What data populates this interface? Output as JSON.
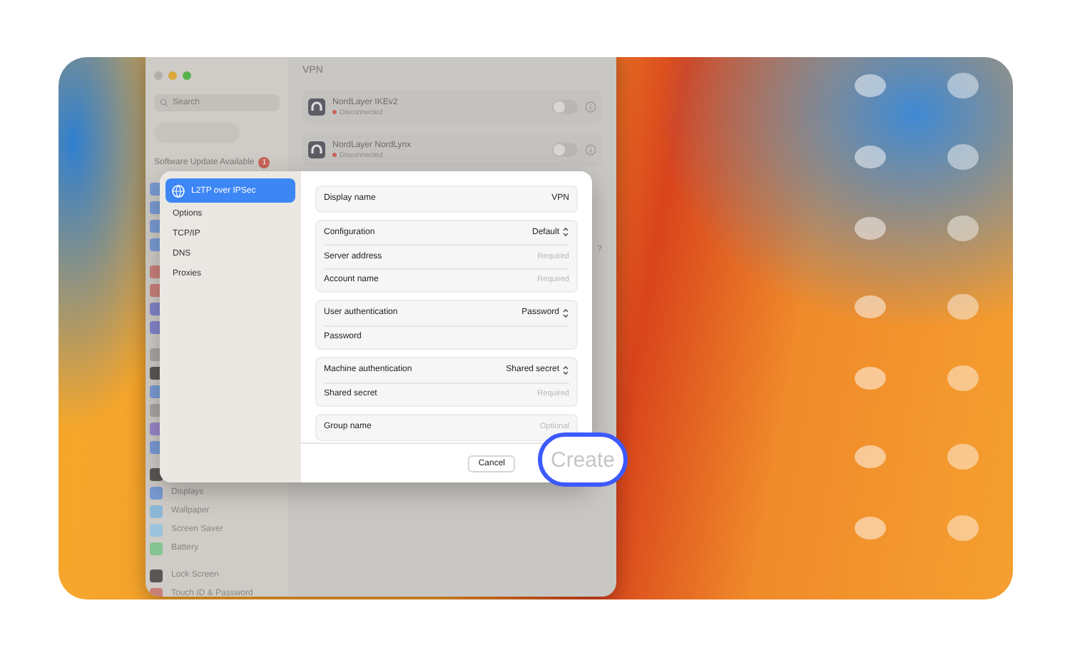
{
  "settings_window": {
    "sidebar": {
      "search": {
        "placeholder": "Search"
      },
      "notice": {
        "text": "Software Update Available",
        "badge": "1"
      },
      "groups": [
        [
          {
            "color": "#7a9cd4"
          },
          {
            "color": "#7a9cd4"
          },
          {
            "color": "#7a9cd4"
          },
          {
            "color": "#7a9cd4"
          }
        ],
        [
          {
            "color": "#c98078"
          },
          {
            "color": "#c98078"
          },
          {
            "color": "#8385c8"
          },
          {
            "color": "#8385c8"
          }
        ],
        [
          {
            "color": "#a9a7a4"
          },
          {
            "color": "#5a5856"
          },
          {
            "color": "#7a9cd4"
          },
          {
            "color": "#a9a7a4"
          },
          {
            "color": "#9a87c8"
          },
          {
            "color": "#7a9cd4"
          }
        ],
        [
          {
            "color": "#5a5856"
          },
          {
            "label": "Displays",
            "color": "#7a9cd4"
          },
          {
            "label": "Wallpaper",
            "color": "#8cb8d8"
          },
          {
            "label": "Screen Saver",
            "color": "#9cc4dc"
          },
          {
            "label": "Battery",
            "color": "#86c392"
          }
        ],
        [
          {
            "label": "Lock Screen",
            "color": "#5a5856"
          },
          {
            "label": "Touch ID & Password",
            "color": "#c98078"
          }
        ]
      ]
    },
    "title": "VPN",
    "connections": [
      {
        "name": "NordLayer IKEv2",
        "status": "Disconnected",
        "on": false
      },
      {
        "name": "NordLayer NordLynx",
        "status": "Disconnected",
        "on": false
      }
    ],
    "help": "?"
  },
  "dialog": {
    "sidebar": [
      {
        "label": "L2TP over IPSec",
        "selected": true
      },
      {
        "label": "Options",
        "selected": false
      },
      {
        "label": "TCP/IP",
        "selected": false
      },
      {
        "label": "DNS",
        "selected": false
      },
      {
        "label": "Proxies",
        "selected": false
      }
    ],
    "groups": [
      [
        {
          "label": "Display name",
          "kind": "text",
          "value": "VPN"
        }
      ],
      [
        {
          "label": "Configuration",
          "kind": "popup",
          "value": "Default"
        },
        {
          "label": "Server address",
          "kind": "field",
          "placeholder": "Required"
        },
        {
          "label": "Account name",
          "kind": "field",
          "placeholder": "Required"
        }
      ],
      [
        {
          "label": "User authentication",
          "kind": "popup",
          "value": "Password"
        },
        {
          "label": "Password",
          "kind": "field"
        }
      ],
      [
        {
          "label": "Machine authentication",
          "kind": "popup",
          "value": "Shared secret"
        },
        {
          "label": "Shared secret",
          "kind": "field",
          "placeholder": "Required"
        }
      ],
      [
        {
          "label": "Group name",
          "kind": "field",
          "placeholder": "Optional"
        }
      ]
    ],
    "buttons": [
      {
        "label": "Cancel",
        "disabled": false,
        "highlighted": false
      },
      {
        "label": "Create",
        "disabled": true,
        "highlighted": true
      }
    ]
  }
}
